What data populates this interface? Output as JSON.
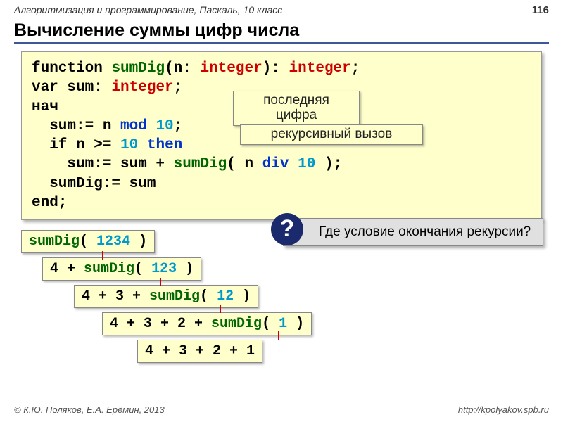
{
  "header": {
    "course": "Алгоритмизация и программирование, Паскаль, 10 класс",
    "page": "116"
  },
  "title": "Вычисление суммы цифр числа",
  "code": {
    "l1_function": "function",
    "l1_name": "sumDig",
    "l1_open": "(n:",
    "l1_type1": "integer",
    "l1_close": "):",
    "l1_type2": "integer",
    "l1_end": ";",
    "l2_var": "var sum:",
    "l2_type": "integer",
    "l2_end": ";",
    "l3": "нач",
    "l4a": "  sum:= n",
    "l4_mod": "mod",
    "l4_10": "10",
    "l4b": ";",
    "l5a": "  if n >=",
    "l5_10": "10",
    "l5b": "then",
    "l6a": "    sum:= sum +",
    "l6_call": "sumDig",
    "l6b": "( n",
    "l6_div": "div",
    "l6_10": "10",
    "l6c": ");",
    "l7": "  sumDig:= sum",
    "l8": "end;"
  },
  "callout1": "последняя цифра",
  "callout2": "рекурсивный вызов",
  "question": {
    "mark": "?",
    "text": "Где условие окончания рекурсии?"
  },
  "trace": {
    "r1_call": "sumDig",
    "r1_open": "(",
    "r1_num": "1234",
    "r1_close": ")",
    "r2_pre": "4 +",
    "r2_call": "sumDig",
    "r2_open": "(",
    "r2_num": "123",
    "r2_close": ")",
    "r3_pre": "4 + 3 +",
    "r3_call": "sumDig",
    "r3_open": "(",
    "r3_num": "12",
    "r3_close": ")",
    "r4_pre": "4 + 3 + 2 +",
    "r4_call": "sumDig",
    "r4_open": "(",
    "r4_num": "1",
    "r4_close": ")",
    "r5": "4 + 3 + 2 + 1"
  },
  "footer": {
    "left": "© К.Ю. Поляков, Е.А. Ерёмин, 2013",
    "right": "http://kpolyakov.spb.ru"
  }
}
